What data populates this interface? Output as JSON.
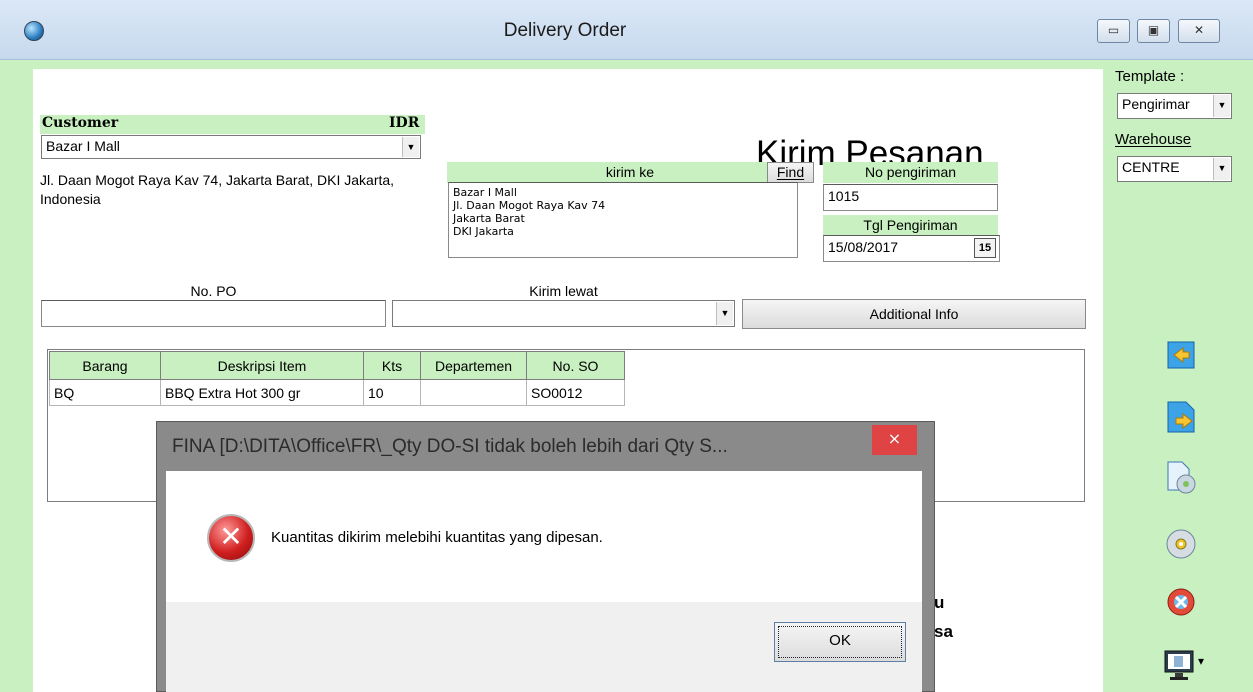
{
  "window": {
    "title": "Delivery Order",
    "minimize_glyph": "▭",
    "maximize_glyph": "▣",
    "close_glyph": "✕"
  },
  "form": {
    "heading": "Kirim Pesanan",
    "customer_label": "Customer",
    "currency": "IDR",
    "customer_value": "Bazar I Mall",
    "customer_address": "Jl. Daan Mogot Raya Kav 74, Jakarta Barat, DKI Jakarta, Indonesia",
    "kirim_ke_label": "kirim ke",
    "find_label": "Find",
    "kirim_ke_lines": [
      "Bazar I Mall",
      "Jl. Daan Mogot Raya Kav 74",
      "Jakarta Barat",
      "DKI Jakarta"
    ],
    "no_pengiriman_label": "No pengiriman",
    "no_pengiriman_value": "1015",
    "tgl_pengiriman_label": "Tgl Pengiriman",
    "tgl_pengiriman_value": "15/08/2017",
    "calendar_glyph": "15",
    "no_po_label": "No. PO",
    "no_po_value": "",
    "kirim_lewat_label": "Kirim lewat",
    "kirim_lewat_value": "",
    "additional_info_label": "Additional Info",
    "dropdown_glyph": "▼"
  },
  "grid": {
    "columns": [
      "Barang",
      "Deskripsi Item",
      "Kts",
      "Departemen",
      "No. SO"
    ],
    "rows": [
      [
        "BQ",
        "BBQ Extra Hot 300 gr",
        "10",
        "",
        "SO0012"
      ]
    ]
  },
  "background_fragments": [
    "u",
    "sa"
  ],
  "right_panel": {
    "template_label": "Template :",
    "template_value": "Pengirimar",
    "warehouse_label": "Warehouse",
    "warehouse_value": "CENTRE",
    "icons": [
      "import-icon",
      "export-icon",
      "document-disc-icon",
      "disc-icon",
      "delete-icon",
      "display-icon"
    ],
    "display_menu_glyph": "▾"
  },
  "dialog": {
    "title": "FINA  [D:\\DITA\\Office\\FR\\_Qty DO-SI tidak boleh lebih dari Qty S...",
    "close_glyph": "×",
    "error_glyph": "✕",
    "message": "Kuantitas dikirim melebihi kuantitas yang dipesan.",
    "ok_label": "OK"
  }
}
